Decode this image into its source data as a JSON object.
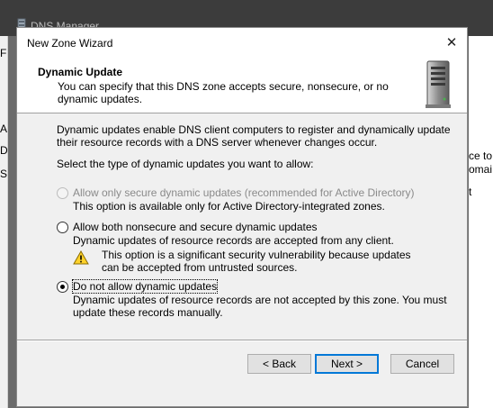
{
  "background_window": {
    "title": "DNS Manager",
    "right_fragments": [
      "ce to",
      "omai",
      "t"
    ],
    "left_fragments": [
      "F",
      "A",
      "D",
      "S"
    ]
  },
  "dialog": {
    "title": "New Zone Wizard",
    "close_glyph": "✕",
    "header": {
      "title": "Dynamic Update",
      "subtitle": "You can specify that this DNS zone accepts secure, nonsecure, or no dynamic updates."
    },
    "intro": "Dynamic updates enable DNS client computers to register and dynamically update their resource records with a DNS server whenever changes occur.",
    "prompt": "Select the type of dynamic updates you want to allow:",
    "options": [
      {
        "label": "Allow only secure dynamic updates (recommended for Active Directory)",
        "description": "This option is available only for Active Directory-integrated zones.",
        "enabled": false,
        "selected": false
      },
      {
        "label": "Allow both nonsecure and secure dynamic updates",
        "description": "Dynamic updates of resource records are accepted from any client.",
        "warning": "This option is a significant security vulnerability because updates can be accepted from untrusted sources.",
        "enabled": true,
        "selected": false
      },
      {
        "label": "Do not allow dynamic updates",
        "description": "Dynamic updates of resource records are not accepted by this zone. You must update these records manually.",
        "enabled": true,
        "selected": true
      }
    ],
    "buttons": {
      "back": "< Back",
      "next": "Next >",
      "cancel": "Cancel"
    }
  }
}
